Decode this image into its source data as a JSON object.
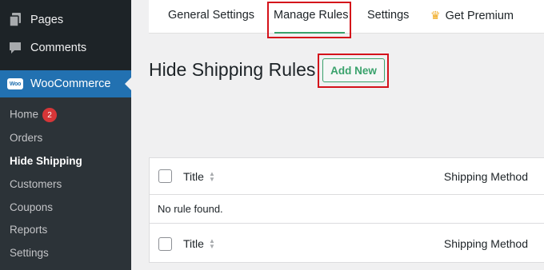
{
  "sidebar": {
    "top_items": [
      {
        "label": "Pages",
        "icon": "pages-icon"
      },
      {
        "label": "Comments",
        "icon": "comments-icon"
      }
    ],
    "woocommerce": {
      "label": "WooCommerce",
      "logo_text": "Woo"
    },
    "submenu": [
      {
        "label": "Home",
        "badge": "2"
      },
      {
        "label": "Orders"
      },
      {
        "label": "Hide Shipping",
        "current": true
      },
      {
        "label": "Customers"
      },
      {
        "label": "Coupons"
      },
      {
        "label": "Reports"
      },
      {
        "label": "Settings"
      }
    ]
  },
  "tabs": [
    {
      "label": "General Settings"
    },
    {
      "label": "Manage Rules",
      "active": true
    },
    {
      "label": "Settings"
    },
    {
      "label": "Get Premium",
      "icon": "crown-icon"
    }
  ],
  "page": {
    "title": "Hide Shipping Rules",
    "add_new_label": "Add New"
  },
  "table": {
    "columns": [
      "Title",
      "Shipping Method"
    ],
    "empty_message": "No rule found."
  },
  "colors": {
    "sidebar_bg": "#1d2327",
    "submenu_bg": "#2c3338",
    "wp_blue": "#2271b1",
    "accent_green": "#3aa26c",
    "badge_red": "#d63638",
    "highlight_red": "#d4121a"
  }
}
